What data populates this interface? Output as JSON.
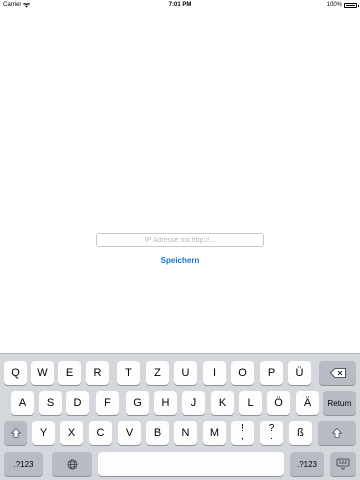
{
  "status_bar": {
    "carrier": "Carrier",
    "wifi_icon": "wifi-icon",
    "time": "7:01 PM",
    "battery_percent": "100%",
    "battery_level": 1.0
  },
  "form": {
    "ip_input": {
      "placeholder": "IP Adresse mit http://...",
      "value": ""
    },
    "save_label": "Speichern"
  },
  "keyboard": {
    "row1": [
      "Q",
      "W",
      "E",
      "R",
      "T",
      "Z",
      "U",
      "I",
      "O",
      "P",
      "Ü"
    ],
    "row2": [
      "A",
      "S",
      "D",
      "F",
      "G",
      "H",
      "J",
      "K",
      "L",
      "Ö",
      "Ä"
    ],
    "row3": [
      "Y",
      "X",
      "C",
      "V",
      "B",
      "N",
      "M",
      "ß"
    ],
    "punct_keys": [
      {
        "top": "!",
        "bottom": ","
      },
      {
        "top": "?",
        "bottom": "."
      }
    ],
    "return_label": "Return",
    "numbers_label": ".?123",
    "icons": {
      "backspace": "backspace-icon",
      "shift": "shift-icon",
      "globe": "globe-icon"
    },
    "accent_color": "#1a73d6"
  }
}
